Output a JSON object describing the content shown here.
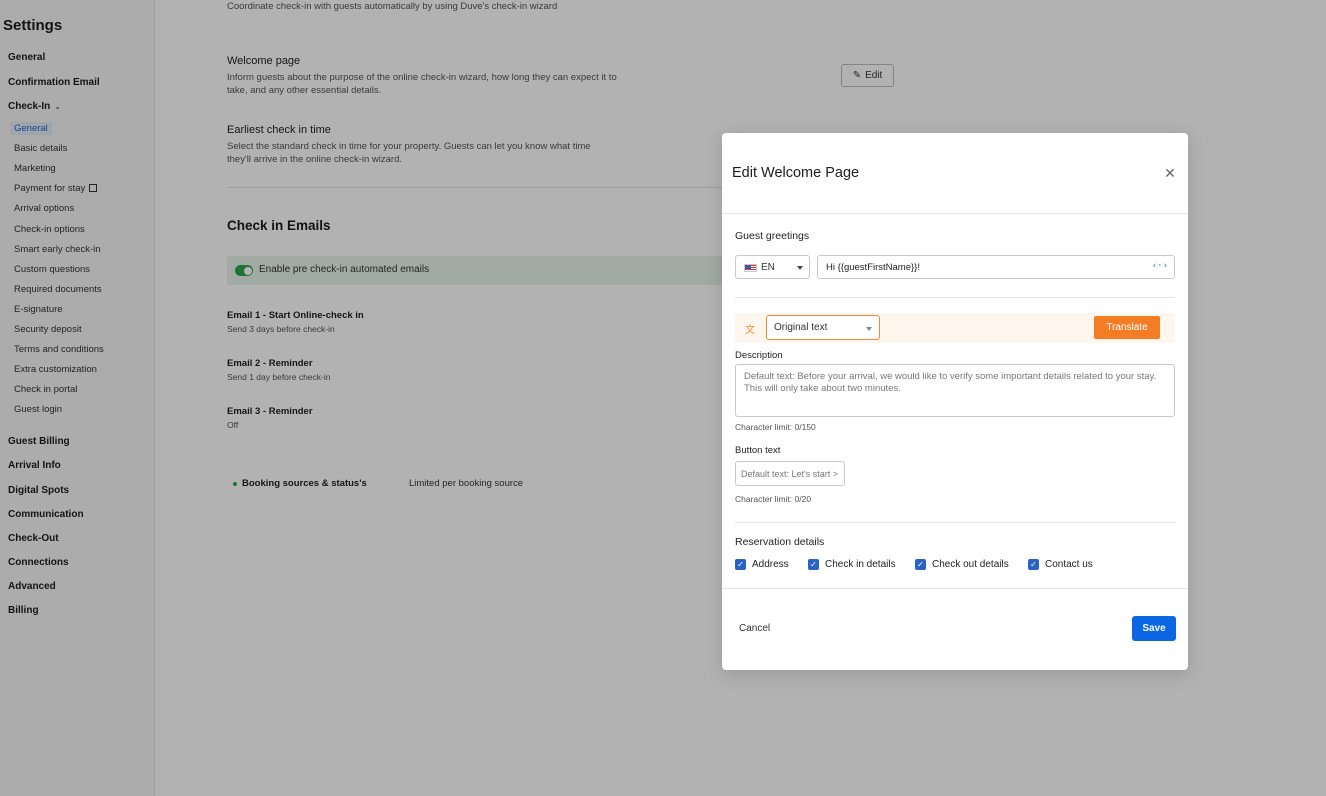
{
  "sidebar": {
    "title": "Settings",
    "items": [
      {
        "label": "General"
      },
      {
        "label": "Confirmation Email"
      },
      {
        "label": "Check-In"
      },
      {
        "label": "Guest Billing"
      },
      {
        "label": "Arrival Info"
      },
      {
        "label": "Digital Spots"
      },
      {
        "label": "Communication"
      },
      {
        "label": "Check-Out"
      },
      {
        "label": "Connections"
      },
      {
        "label": "Advanced"
      },
      {
        "label": "Billing"
      }
    ],
    "checkin_sub": [
      {
        "label": "General"
      },
      {
        "label": "Basic details"
      },
      {
        "label": "Marketing"
      },
      {
        "label": "Payment for stay"
      },
      {
        "label": "Arrival options"
      },
      {
        "label": "Check-in options"
      },
      {
        "label": "Smart early check-in"
      },
      {
        "label": "Custom questions"
      },
      {
        "label": "Required documents"
      },
      {
        "label": "E-signature"
      },
      {
        "label": "Security deposit"
      },
      {
        "label": "Terms and conditions"
      },
      {
        "label": "Extra customization"
      },
      {
        "label": "Check in portal"
      },
      {
        "label": "Guest login"
      }
    ]
  },
  "main": {
    "intro": "Coordinate check-in with guests automatically by using Duve's check-in wizard",
    "welcome_title": "Welcome page",
    "welcome_desc": "Inform guests about the purpose of the online check-in wizard, how long they can expect it to take, and any other essential details.",
    "edit_label": "Edit",
    "earliest_title": "Earliest check in time",
    "earliest_desc": "Select the standard check in time for your property. Guests can let you know what time they'll arrive in the online check-in wizard.",
    "emails_title": "Check in Emails",
    "toggle_label": "Enable pre check-in automated emails",
    "emails": [
      {
        "title": "Email 1 - Start Online-check in",
        "sub": "Send 3 days before check-in"
      },
      {
        "title": "Email 2 - Reminder",
        "sub": "Send 1 day before check-in"
      },
      {
        "title": "Email 3 - Reminder",
        "sub": "Off"
      }
    ],
    "booking_label": "Booking sources & status's",
    "booking_value": "Limited per booking source"
  },
  "modal": {
    "title": "Edit Welcome Page",
    "guest_greetings_label": "Guest greetings",
    "language": "EN",
    "greeting_value": "Hi {{guestFirstName}}!",
    "original_text": "Original text",
    "translate_label": "Translate",
    "description_label": "Description",
    "description_placeholder": "Default text: Before your arrival, we would like to verify some important details related to your stay. This will only take about two minutes.",
    "description_limit": "Character limit: 0/150",
    "button_text_label": "Button text",
    "button_text_placeholder": "Default text: Let's start >",
    "button_text_limit": "Character limit: 0/20",
    "reservation_label": "Reservation details",
    "checkboxes": [
      {
        "label": "Address",
        "checked": true
      },
      {
        "label": "Check in details",
        "checked": true
      },
      {
        "label": "Check out details",
        "checked": true
      },
      {
        "label": "Contact us",
        "checked": true
      }
    ],
    "cancel_label": "Cancel",
    "save_label": "Save"
  },
  "colors": {
    "primary": "#0b66e4",
    "accent_orange": "#f47c24",
    "toggle_green": "#2ea44f"
  }
}
